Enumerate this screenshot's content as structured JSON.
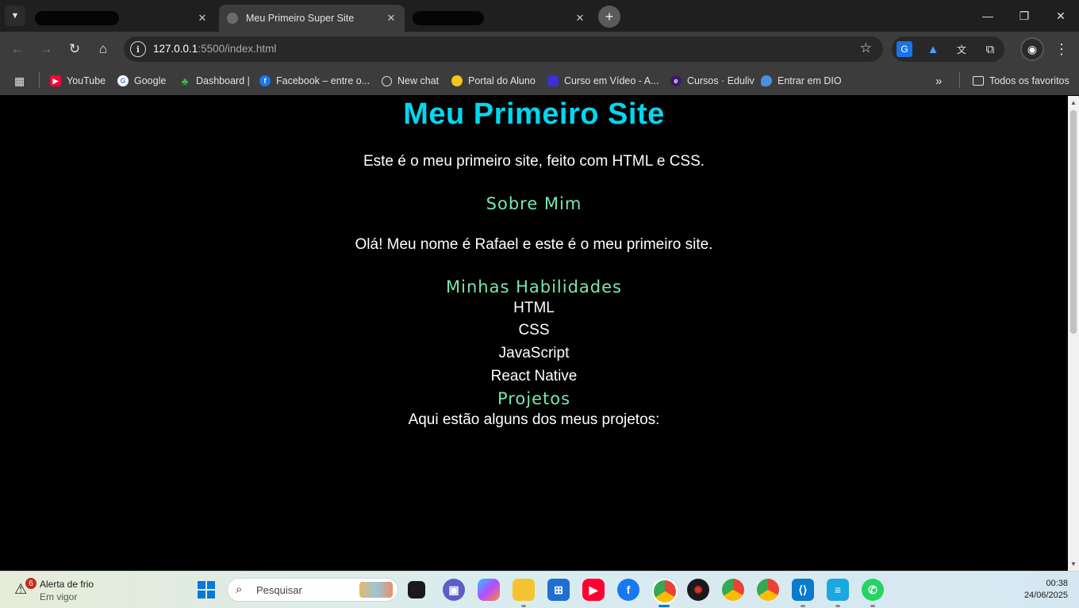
{
  "browser": {
    "tabs": [
      {
        "title": "",
        "redacted": true,
        "active": false
      },
      {
        "title": "Meu Primeiro Super Site",
        "active": true
      },
      {
        "title": "",
        "redacted": true,
        "active": false
      }
    ],
    "url_host": "127.0.0.1",
    "url_rest": ":5500/index.html",
    "bookmarks": [
      {
        "label": "YouTube",
        "icon": "youtube-icon",
        "color": "#ff0033"
      },
      {
        "label": "Google",
        "icon": "google-icon",
        "color": "#ffffff"
      },
      {
        "label": "Dashboard |",
        "icon": "dashboard-icon",
        "color": "#3fb950"
      },
      {
        "label": "Facebook – entre o...",
        "icon": "facebook-icon",
        "color": "#1877f2"
      },
      {
        "label": "New chat",
        "icon": "chatgpt-icon",
        "color": "#ffffff"
      },
      {
        "label": "Portal do Aluno",
        "icon": "portal-icon",
        "color": "#f5c518"
      },
      {
        "label": "Curso em Vídeo - A...",
        "icon": "cursoemvideo-icon",
        "color": "#3b2fd6"
      },
      {
        "label": "Cursos · Eduliv",
        "icon": "eduliv-icon",
        "color": "#3a1a6e"
      },
      {
        "label": "Entrar em DIO",
        "icon": "dio-icon",
        "color": "#4a90e2"
      }
    ],
    "all_bookmarks_label": "Todos os favoritos"
  },
  "page": {
    "title": "Meu Primeiro Site",
    "intro": "Este é o meu primeiro site, feito com HTML e CSS.",
    "about_heading": "Sobre Mim",
    "about_text": "Olá! Meu nome é Rafael e este é o meu primeiro site.",
    "skills_heading": "Minhas Habilidades",
    "skills": [
      "HTML",
      "CSS",
      "JavaScript",
      "React Native"
    ],
    "projects_heading": "Projetos",
    "projects_text": "Aqui estão alguns dos meus projetos:",
    "colors": {
      "title": "#00d8f0",
      "heading": "#78e8b0",
      "text": "#ffffff",
      "background": "#000000"
    }
  },
  "taskbar": {
    "weather_title": "Alerta de frio",
    "weather_status": "Em vigor",
    "weather_badge": "6",
    "search_placeholder": "Pesquisar",
    "time": "00:38",
    "date": "24/06/2025"
  }
}
